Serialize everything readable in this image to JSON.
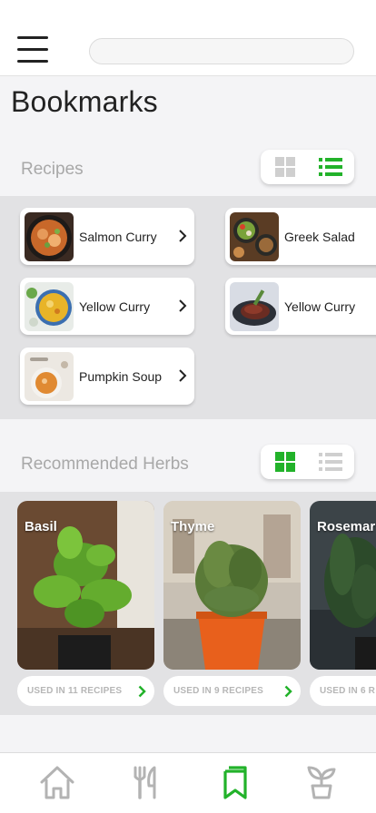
{
  "header": {
    "search_placeholder": "",
    "search_value": ""
  },
  "page": {
    "title": "Bookmarks"
  },
  "recipes_section": {
    "title": "Recipes",
    "view_mode": "list",
    "items": [
      {
        "name": "Salmon Curry",
        "image": "salmon-curry-photo"
      },
      {
        "name": "Greek Salad",
        "image": "greek-salad-photo"
      },
      {
        "name": "Yellow Curry",
        "image": "yellow-curry-photo"
      },
      {
        "name": "Yellow Curry",
        "image": "steak-photo"
      },
      {
        "name": "Pumpkin Soup",
        "image": "pumpkin-soup-photo"
      }
    ]
  },
  "herbs_section": {
    "title": "Recommended Herbs",
    "view_mode": "grid",
    "items": [
      {
        "name": "Basil",
        "used": "USED IN 11 RECIPES"
      },
      {
        "name": "Thyme",
        "used": "USED IN 9 RECIPES"
      },
      {
        "name": "Rosemar",
        "used": "USED IN 6 R"
      }
    ]
  },
  "bottom_nav": {
    "items": [
      "home-icon",
      "utensils-icon",
      "bookmark-icon",
      "herb-icon"
    ],
    "active": "bookmark-icon"
  },
  "colors": {
    "accent": "#22b22a",
    "inactive": "#b3b3b3",
    "section_bg": "#e2e2e4",
    "page_bg": "#f4f4f6"
  }
}
